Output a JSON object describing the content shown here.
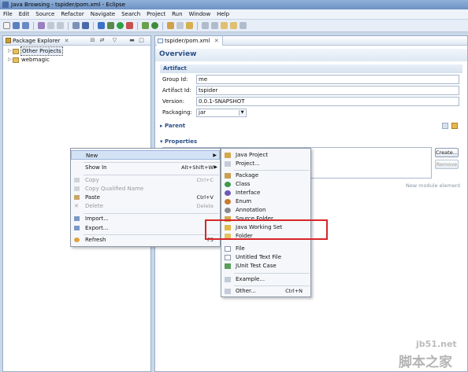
{
  "window": {
    "title": "Java Browsing - tspider/pom.xml - Eclipse"
  },
  "menu": [
    "File",
    "Edit",
    "Source",
    "Refactor",
    "Navigate",
    "Search",
    "Project",
    "Run",
    "Window",
    "Help"
  ],
  "package_explorer": {
    "tab_label": "Package Explorer",
    "tree": [
      {
        "label": "Other Projects",
        "selected": true
      },
      {
        "label": "webmagic",
        "selected": false
      }
    ]
  },
  "editor": {
    "tab_label": "tspider/pom.xml",
    "page_title": "Overview",
    "artifact_section": "Artifact",
    "fields": {
      "group_id_label": "Group Id:",
      "group_id_value": "me",
      "artifact_id_label": "Artifact Id:",
      "artifact_id_value": "tspider",
      "version_label": "Version:",
      "version_value": "0.0.1-SNAPSHOT",
      "packaging_label": "Packaging:",
      "packaging_value": "jar"
    },
    "parent_section": "Parent",
    "properties_section": "Properties",
    "create_button": "Create...",
    "remove_button": "Remove",
    "new_module_text": "New module element"
  },
  "context_menu": {
    "new": "New",
    "show_in": "Show In",
    "show_in_shortcut": "Alt+Shift+W",
    "copy": "Copy",
    "copy_shortcut": "Ctrl+C",
    "copy_qualified": "Copy Qualified Name",
    "paste": "Paste",
    "paste_shortcut": "Ctrl+V",
    "delete": "Delete",
    "delete_shortcut": "Delete",
    "import": "Import...",
    "export": "Export...",
    "refresh": "Refresh",
    "refresh_shortcut": "F5"
  },
  "submenu": {
    "java_project": "Java Project",
    "project": "Project...",
    "package": "Package",
    "class": "Class",
    "interface": "Interface",
    "enum": "Enum",
    "annotation": "Annotation",
    "source_folder": "Source Folder",
    "java_working_set": "Java Working Set",
    "folder": "Folder",
    "file": "File",
    "untitled_text_file": "Untitled Text File",
    "junit_test_case": "JUnit Test Case",
    "example": "Example...",
    "other": "Other...",
    "other_shortcut": "Ctrl+N"
  },
  "watermark": {
    "line1": "jb51.net",
    "line2": "脚本之家"
  }
}
